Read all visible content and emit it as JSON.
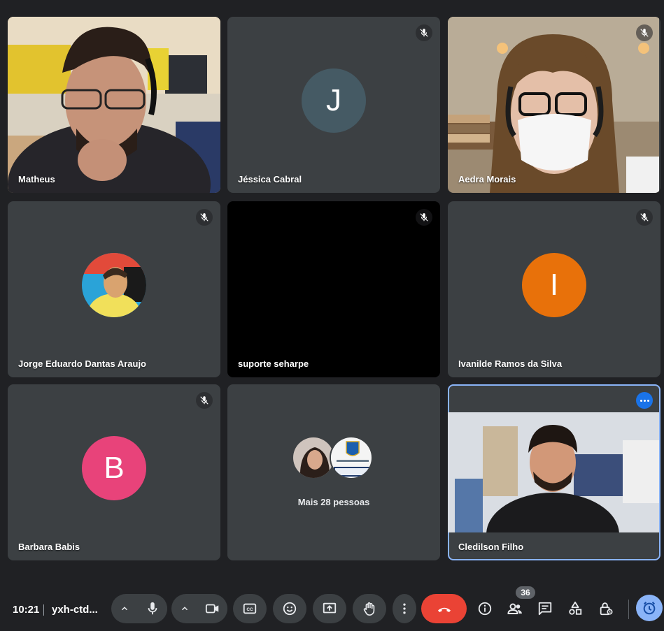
{
  "participants": [
    {
      "name": "Matheus",
      "type": "video"
    },
    {
      "name": "Jéssica Cabral",
      "type": "initial",
      "initial": "J",
      "avatar_color": "#455a64",
      "muted": true
    },
    {
      "name": "Aedra Morais",
      "type": "video",
      "muted": true
    },
    {
      "name": "Jorge Eduardo Dantas Araujo",
      "type": "photo",
      "muted": true
    },
    {
      "name": "suporte seharpe",
      "type": "black",
      "muted": true
    },
    {
      "name": "Ivanilde Ramos da Silva",
      "type": "initial",
      "initial": "I",
      "avatar_color": "#e8710a",
      "muted": true
    },
    {
      "name": "Barbara Babis",
      "type": "initial",
      "initial": "B",
      "avatar_color": "#e8437a",
      "muted": true
    },
    {
      "name": "Cledilson Filho",
      "type": "video",
      "selected": true
    }
  ],
  "group_tile": {
    "label": "Mais 28 pessoas"
  },
  "bottom_bar": {
    "time": "10:21",
    "meeting_code": "yxh-ctd...",
    "participant_count": "36"
  },
  "icons": {
    "mic": "mic-icon",
    "camera": "camera-icon",
    "captions": "captions-icon",
    "emoji": "emoji-icon",
    "present": "present-icon",
    "raise_hand": "raise-hand-icon",
    "more": "more-vert-icon",
    "hangup": "hangup-icon",
    "info": "info-icon",
    "people": "people-icon",
    "chat": "chat-icon",
    "activities": "activities-icon",
    "host_controls": "host-controls-icon",
    "timer": "timer-icon"
  },
  "colors": {
    "background": "#202124",
    "tile": "#3c4043",
    "hangup": "#ea4335",
    "accent": "#8ab4f8"
  }
}
